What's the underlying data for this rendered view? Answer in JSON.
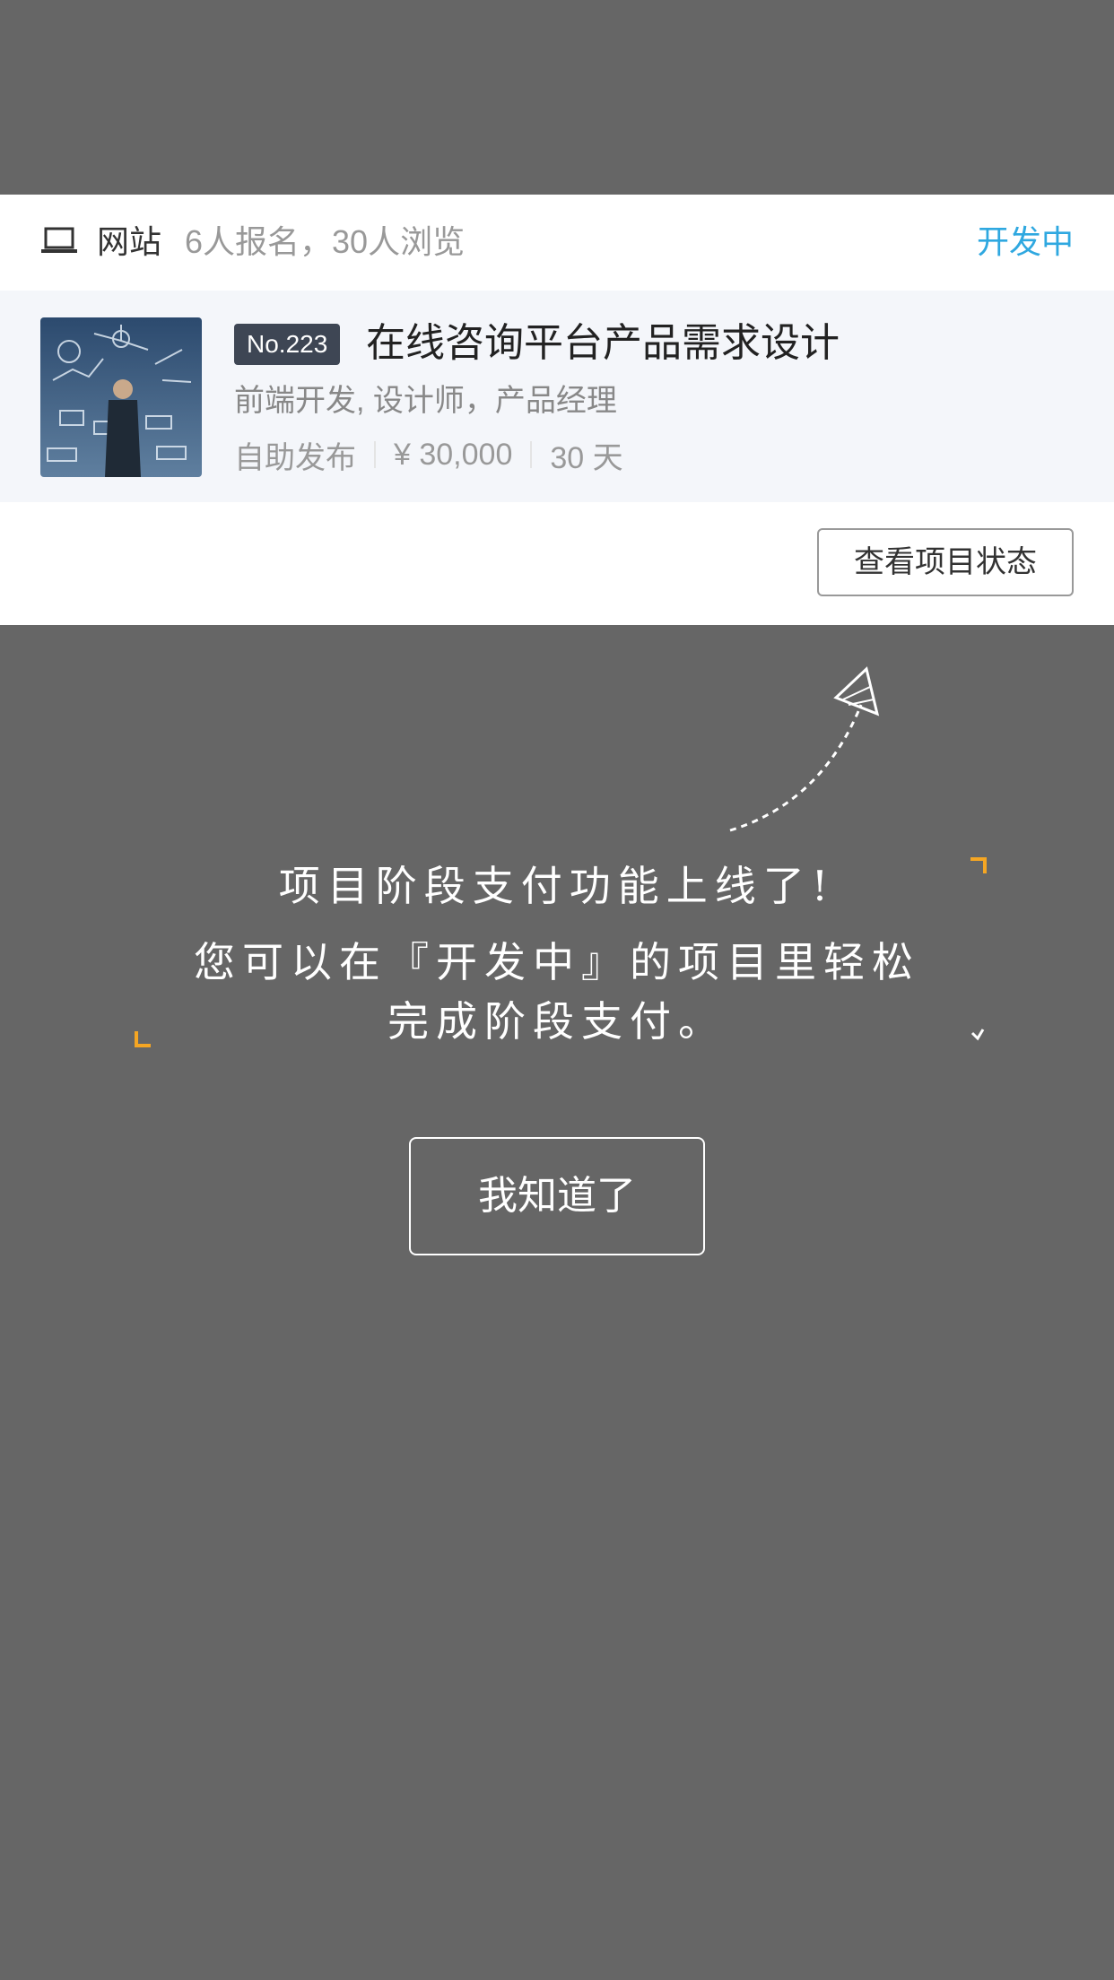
{
  "project": {
    "category": "网站",
    "stats": "6人报名，30人浏览",
    "status": "开发中",
    "number_badge": "No.223",
    "title": "在线咨询平台产品需求设计",
    "roles": "前端开发, 设计师，产品经理",
    "publish_type": "自助发布",
    "budget": "¥ 30,000",
    "duration": "30 天",
    "view_status_label": "查看项目状态"
  },
  "overlay": {
    "line1": "项目阶段支付功能上线了!",
    "line2": "您可以在『开发中』的项目里轻松",
    "line3": "完成阶段支付。",
    "confirm_label": "我知道了"
  },
  "colors": {
    "overlay": "#666666",
    "accent": "#2fa8e0",
    "bracket": "#f5a623",
    "badge": "#3e4654"
  }
}
